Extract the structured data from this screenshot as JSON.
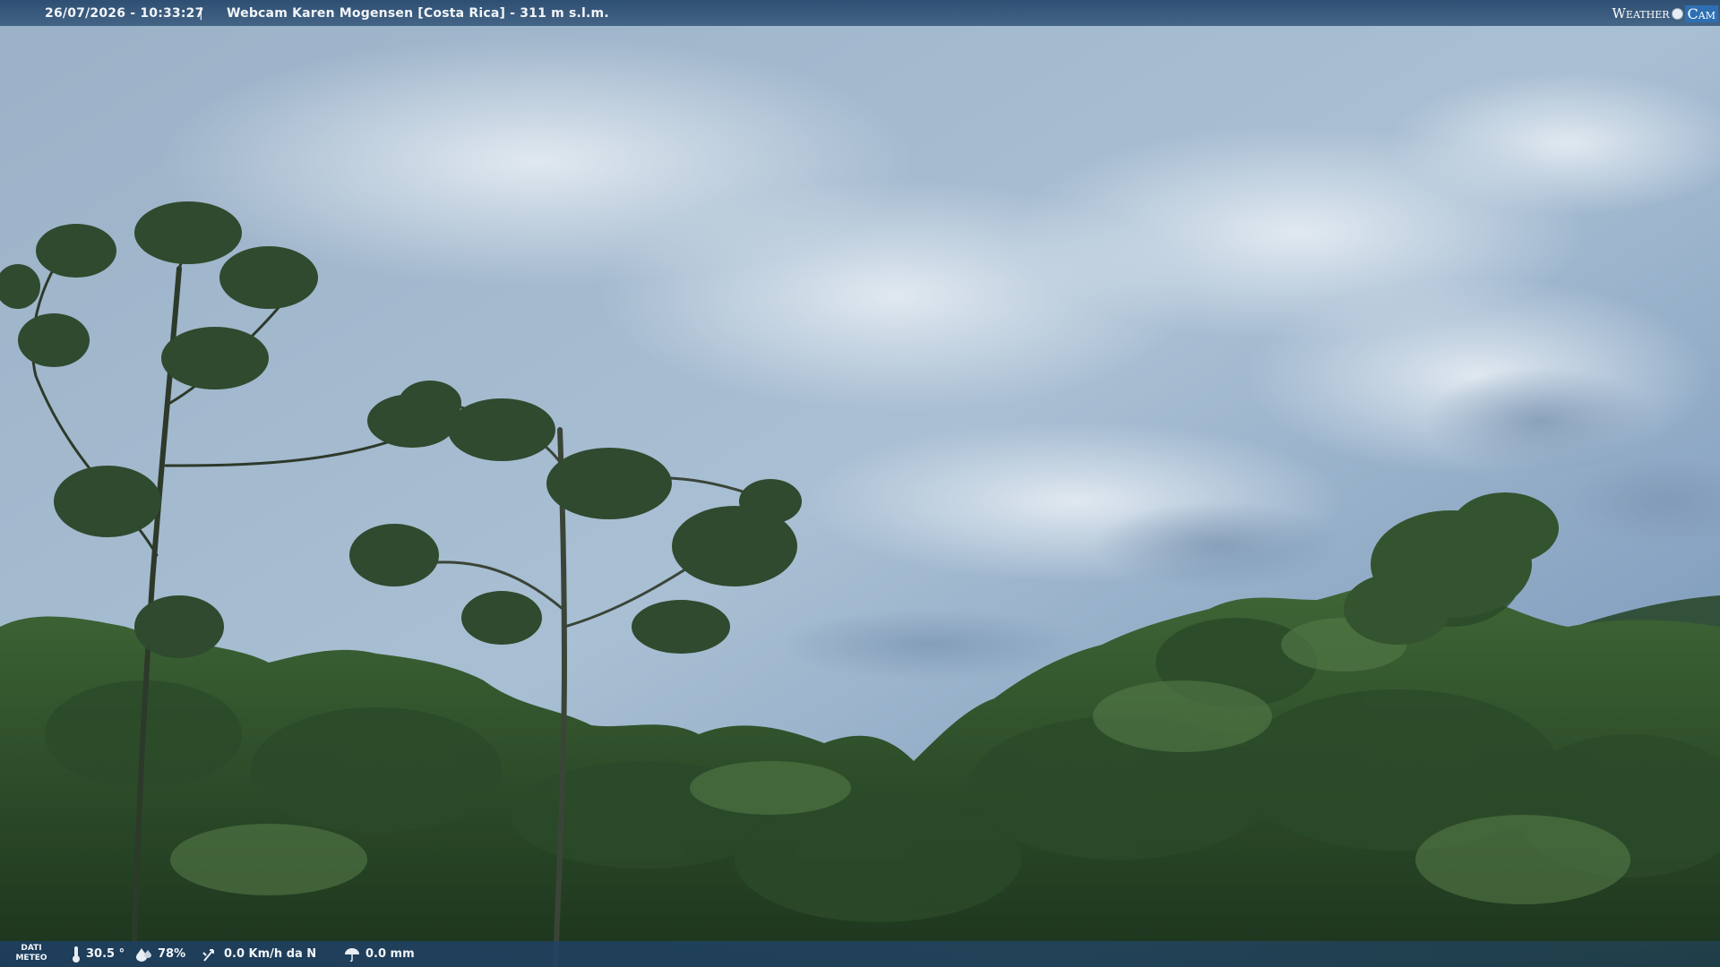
{
  "header": {
    "datetime": "26/07/2026 - 10:33:27",
    "separator": "|",
    "title": "Webcam Karen Mogensen [Costa Rica]  - 311 m s.l.m.",
    "logo_word": "Weather",
    "logo_cam": "Cam"
  },
  "footer": {
    "dati_line1": "DATI",
    "dati_line2": "METEO",
    "temperature": "30.5 °",
    "humidity": "78%",
    "wind": "0.0 Km/h da N",
    "rain": "0.0 mm",
    "icons": [
      "thermometer-icon",
      "humidity-icon",
      "wind-icon",
      "rain-icon"
    ]
  },
  "colors": {
    "sky": "#8fa9c4",
    "cloud": "#d5e0ea",
    "foliage_dark": "#1f3a22",
    "foliage_mid": "#3d6134",
    "bar": "#2c5580"
  }
}
